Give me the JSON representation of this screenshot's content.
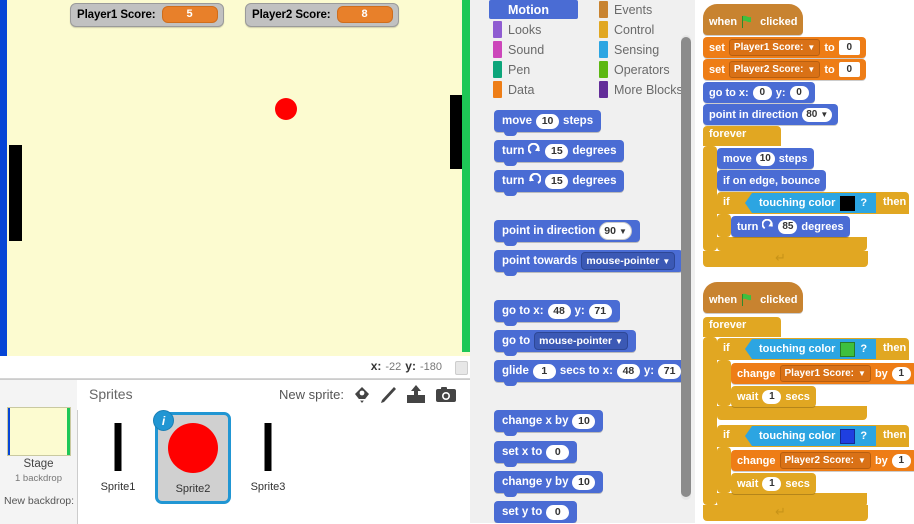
{
  "app": "Scratch",
  "stage": {
    "watchers": [
      {
        "label": "Player1 Score:",
        "value": "5"
      },
      {
        "label": "Player2 Score:",
        "value": "8"
      }
    ],
    "coords": {
      "x_label": "x:",
      "x_value": "-22",
      "y_label": "y:",
      "y_value": "-180"
    },
    "colors": {
      "background": "#fcfbd0",
      "left_edge": "#0645d6",
      "right_edge": "#1ec756",
      "ball": "#ff0000",
      "paddle": "#000000"
    }
  },
  "sprite_pane": {
    "stage_name": "Stage",
    "stage_sub": "1 backdrop",
    "new_backdrop_label": "New backdrop:",
    "sprites_title": "Sprites",
    "new_sprite_label": "New sprite:",
    "tools": [
      "sprite-library-icon",
      "paint-brush-icon",
      "upload-icon",
      "camera-icon"
    ],
    "sprites": [
      {
        "name": "Sprite1",
        "kind": "bar",
        "selected": false
      },
      {
        "name": "Sprite2",
        "kind": "ball",
        "selected": true
      },
      {
        "name": "Sprite3",
        "kind": "bar",
        "selected": false
      }
    ]
  },
  "palette": {
    "categories": [
      {
        "name": "Motion",
        "color": "#4a6cd4",
        "active": true
      },
      {
        "name": "Events",
        "color": "#c88330",
        "active": false
      },
      {
        "name": "Looks",
        "color": "#8f5cd1",
        "active": false
      },
      {
        "name": "Control",
        "color": "#e1a722",
        "active": false
      },
      {
        "name": "Sound",
        "color": "#cc46ba",
        "active": false
      },
      {
        "name": "Sensing",
        "color": "#2ca5e2",
        "active": false
      },
      {
        "name": "Pen",
        "color": "#0da57a",
        "active": false
      },
      {
        "name": "Operators",
        "color": "#5cb712",
        "active": false
      },
      {
        "name": "Data",
        "color": "#ee7d16",
        "active": false
      },
      {
        "name": "More Blocks",
        "color": "#632d99",
        "active": false
      }
    ],
    "blocks": {
      "move": {
        "w1": "move",
        "n": "10",
        "w2": "steps"
      },
      "turn_cw": {
        "w1": "turn",
        "icon": "turn-right-icon",
        "n": "15",
        "w2": "degrees"
      },
      "turn_ccw": {
        "w1": "turn",
        "icon": "turn-left-icon",
        "n": "15",
        "w2": "degrees"
      },
      "point_dir": {
        "w1": "point in direction",
        "n": "90"
      },
      "point_towards": {
        "w1": "point towards",
        "target": "mouse-pointer"
      },
      "go_to_xy": {
        "w1": "go to x:",
        "x": "48",
        "w2": "y:",
        "y": "71"
      },
      "go_to": {
        "w1": "go to",
        "target": "mouse-pointer"
      },
      "glide": {
        "w1": "glide",
        "secs": "1",
        "w2": "secs to x:",
        "x": "48",
        "w3": "y:",
        "y": "71"
      },
      "change_x": {
        "w1": "change x by",
        "n": "10"
      },
      "set_x": {
        "w1": "set x to",
        "n": "0"
      },
      "change_y": {
        "w1": "change y by",
        "n": "10"
      },
      "set_y": {
        "w1": "set y to",
        "n": "0"
      }
    }
  },
  "scripts": {
    "script1": {
      "hat": {
        "w1": "when",
        "icon": "green-flag-icon",
        "w2": "clicked"
      },
      "set_p1": {
        "w1": "set",
        "var": "Player1 Score:",
        "w2": "to",
        "val": "0"
      },
      "set_p2": {
        "w1": "set",
        "var": "Player2 Score:",
        "w2": "to",
        "val": "0"
      },
      "go_to_xy": {
        "w1": "go to x:",
        "x": "0",
        "w2": "y:",
        "y": "0"
      },
      "point_dir": {
        "w1": "point in direction",
        "n": "80"
      },
      "forever": {
        "label": "forever"
      },
      "move": {
        "w1": "move",
        "n": "10",
        "w2": "steps"
      },
      "bounce": {
        "label": "if on edge, bounce"
      },
      "if_touch": {
        "if": "if",
        "w1": "touching color",
        "color": "#000000",
        "q": "?",
        "then": "then"
      },
      "turn": {
        "w1": "turn",
        "icon": "turn-right-icon",
        "n": "85",
        "w2": "degrees"
      }
    },
    "script2": {
      "hat": {
        "w1": "when",
        "icon": "green-flag-icon",
        "w2": "clicked"
      },
      "forever": {
        "label": "forever"
      },
      "if_green": {
        "if": "if",
        "w1": "touching color",
        "color": "#3ec03e",
        "q": "?",
        "then": "then"
      },
      "change_p1": {
        "w1": "change",
        "var": "Player1 Score:",
        "w2": "by",
        "val": "1"
      },
      "wait1": {
        "w1": "wait",
        "n": "1",
        "w2": "secs"
      },
      "if_blue": {
        "if": "if",
        "w1": "touching color",
        "color": "#1f3fe0",
        "q": "?",
        "then": "then"
      },
      "change_p2": {
        "w1": "change",
        "var": "Player2 Score:",
        "w2": "by",
        "val": "1"
      },
      "wait2": {
        "w1": "wait",
        "n": "1",
        "w2": "secs"
      }
    }
  }
}
